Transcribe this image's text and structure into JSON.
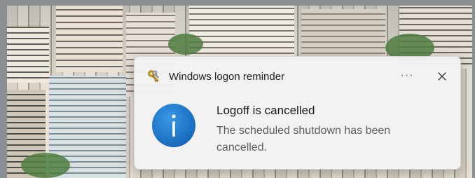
{
  "notification": {
    "app_name": "Windows logon reminder",
    "more_icon": "ellipsis-icon",
    "close_icon": "close-icon",
    "app_icon": "keys-icon",
    "main_icon": "info-icon",
    "title": "Logoff is cancelled",
    "body": "The scheduled shutdown has been cancelled.",
    "more_glyph": "···"
  },
  "colors": {
    "info_blue": "#1a73c8",
    "toast_bg": "#f3f3f3"
  }
}
